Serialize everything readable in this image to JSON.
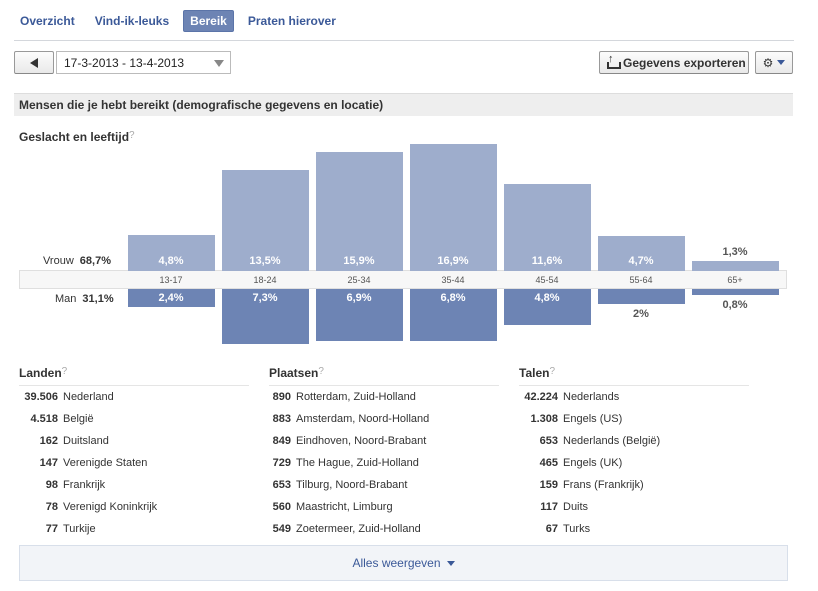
{
  "nav": {
    "tabs": [
      {
        "label": "Overzicht"
      },
      {
        "label": "Vind-ik-leuks"
      },
      {
        "label": "Bereik",
        "active": true
      },
      {
        "label": "Praten hierover"
      }
    ]
  },
  "toolbar": {
    "date_range": "17-3-2013 - 13-4-2013",
    "export_label": "Gegevens exporteren",
    "settings_icon": "gear-icon"
  },
  "section": {
    "title": "Mensen die je hebt bereikt (demografische gegevens en locatie)",
    "subtitle": "Geslacht en leeftijd",
    "help_mark": "?"
  },
  "chart_data": {
    "type": "bar",
    "categories": [
      "13-17",
      "18-24",
      "25-34",
      "35-44",
      "45-54",
      "55-64",
      "65+"
    ],
    "series": [
      {
        "name": "Vrouw",
        "total": "68,7%",
        "values": [
          4.8,
          13.5,
          15.9,
          16.9,
          11.6,
          4.7,
          1.3
        ],
        "labels": [
          "4,8%",
          "13,5%",
          "15,9%",
          "16,9%",
          "11,6%",
          "4,7%",
          "1,3%"
        ]
      },
      {
        "name": "Man",
        "total": "31,1%",
        "values": [
          2.4,
          7.3,
          6.9,
          6.8,
          4.8,
          2.0,
          0.8
        ],
        "labels": [
          "2,4%",
          "7,3%",
          "6,9%",
          "6,8%",
          "4,8%",
          "2%",
          "0,8%"
        ]
      }
    ],
    "colors": {
      "female": "#9eadcc",
      "male": "#6d84b4"
    }
  },
  "lists": {
    "countries": {
      "title": "Landen",
      "rows": [
        {
          "num": "39.506",
          "label": "Nederland"
        },
        {
          "num": "4.518",
          "label": "België"
        },
        {
          "num": "162",
          "label": "Duitsland"
        },
        {
          "num": "147",
          "label": "Verenigde Staten"
        },
        {
          "num": "98",
          "label": "Frankrijk"
        },
        {
          "num": "78",
          "label": "Verenigd Koninkrijk"
        },
        {
          "num": "77",
          "label": "Turkije"
        }
      ]
    },
    "cities": {
      "title": "Plaatsen",
      "rows": [
        {
          "num": "890",
          "label": "Rotterdam, Zuid-Holland"
        },
        {
          "num": "883",
          "label": "Amsterdam, Noord-Holland"
        },
        {
          "num": "849",
          "label": "Eindhoven, Noord-Brabant"
        },
        {
          "num": "729",
          "label": "The Hague, Zuid-Holland"
        },
        {
          "num": "653",
          "label": "Tilburg, Noord-Brabant"
        },
        {
          "num": "560",
          "label": "Maastricht, Limburg"
        },
        {
          "num": "549",
          "label": "Zoetermeer, Zuid-Holland"
        }
      ]
    },
    "languages": {
      "title": "Talen",
      "rows": [
        {
          "num": "42.224",
          "label": "Nederlands"
        },
        {
          "num": "1.308",
          "label": "Engels (US)"
        },
        {
          "num": "653",
          "label": "Nederlands (België)"
        },
        {
          "num": "465",
          "label": "Engels (UK)"
        },
        {
          "num": "159",
          "label": "Frans (Frankrijk)"
        },
        {
          "num": "117",
          "label": "Duits"
        },
        {
          "num": "67",
          "label": "Turks"
        }
      ]
    }
  },
  "footer": {
    "show_all_label": "Alles weergeven"
  }
}
